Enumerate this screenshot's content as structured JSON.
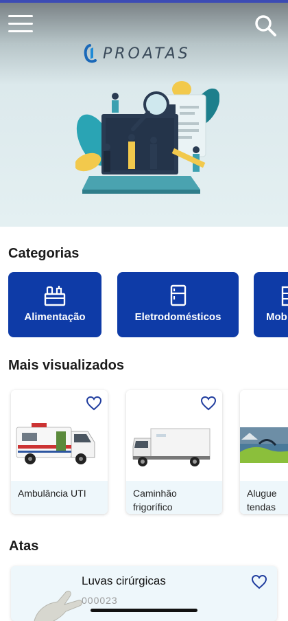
{
  "app": {
    "logo_text": "PROATAS"
  },
  "icons": {
    "menu": "menu-icon",
    "search": "search-icon",
    "favorite": "heart-icon"
  },
  "colors": {
    "primary": "#0e3ba7",
    "accent": "#1f3c9e",
    "caption_bg": "#eef7fb"
  },
  "sections": {
    "categories_title": "Categorias",
    "most_viewed_title": "Mais visualizados",
    "atas_title": "Atas"
  },
  "categories": [
    {
      "label": "Alimentação",
      "icon": "food-icon"
    },
    {
      "label": "Eletrodomésticos",
      "icon": "fridge-icon"
    },
    {
      "label": "Mob",
      "icon": "furniture-icon"
    }
  ],
  "most_viewed": [
    {
      "title_line1": "Ambulância UTI",
      "title_line2": ""
    },
    {
      "title_line1": "Caminhão",
      "title_line2": "frigorífico"
    },
    {
      "title_line1": "Alugue",
      "title_line2": "tendas"
    }
  ],
  "atas": [
    {
      "title": "Luvas cirúrgicas",
      "code": "000023"
    }
  ]
}
